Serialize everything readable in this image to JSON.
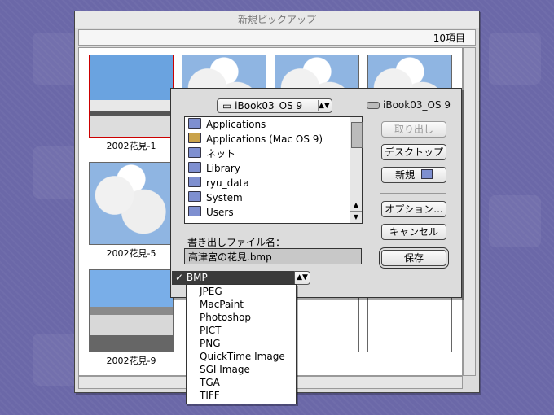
{
  "window": {
    "title": "新規ピックアップ",
    "item_count": "10項目",
    "thumbnails": [
      {
        "caption": "2002花見-1",
        "selected": true
      },
      {
        "caption": "2002花見-5",
        "selected": false
      },
      {
        "caption": "2002花見-9",
        "selected": false
      }
    ]
  },
  "dialog": {
    "location_popup": "iBook03_OS 9",
    "volume_label": "iBook03_OS 9",
    "files": [
      {
        "name": "Applications",
        "icon": "folder-icon"
      },
      {
        "name": "Applications (Mac OS 9)",
        "icon": "app-folder-icon"
      },
      {
        "name": "ネット",
        "icon": "folder-icon"
      },
      {
        "name": "Library",
        "icon": "folder-icon"
      },
      {
        "name": "ryu_data",
        "icon": "folder-icon"
      },
      {
        "name": "System",
        "icon": "folder-icon"
      },
      {
        "name": "Users",
        "icon": "folder-icon"
      }
    ],
    "buttons": {
      "eject": "取り出し",
      "desktop": "デスクトップ",
      "new": "新規",
      "options": "オプション...",
      "cancel": "キャンセル",
      "save": "保存"
    },
    "filename_label": "書き出しファイル名：",
    "filename_value": "高津宮の花見.bmp"
  },
  "format_menu": {
    "selected": "BMP",
    "items": [
      "JPEG",
      "MacPaint",
      "Photoshop",
      "PICT",
      "PNG",
      "QuickTime Image",
      "SGI Image",
      "TGA",
      "TIFF"
    ]
  },
  "colors": {
    "desktop": "#6b68a8",
    "dialog_bg": "#dcdcdc",
    "menu_highlight": "#3a3a3a"
  }
}
